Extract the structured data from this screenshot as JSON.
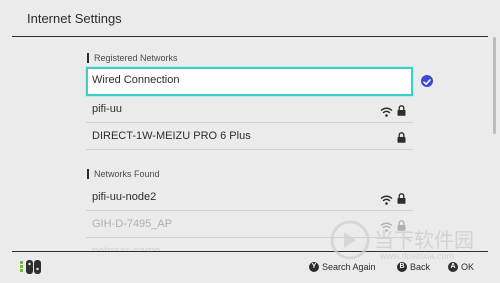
{
  "window": {
    "title": "Internet Settings"
  },
  "sections": {
    "registered": {
      "label": "Registered Networks"
    },
    "found": {
      "label": "Networks Found"
    }
  },
  "networks": {
    "registered": [
      {
        "name": "Wired Connection",
        "selected": true,
        "connected": true
      },
      {
        "name": "pifi-uu",
        "wifi": true,
        "lock": true
      },
      {
        "name": "DIRECT-1W-MEIZU PRO 6 Plus",
        "lock": true
      }
    ],
    "found": [
      {
        "name": "pifi-uu-node2",
        "wifi": true,
        "lock": true
      },
      {
        "name": "GIH-D-7495_AP",
        "wifi": true,
        "lock": true
      },
      {
        "name": "netgear-game",
        "wifi": false
      }
    ]
  },
  "footer": {
    "controller_icon": "joycon-icon",
    "hints": [
      {
        "button": "Y",
        "label": "Search Again"
      },
      {
        "button": "B",
        "label": "Back"
      },
      {
        "button": "A",
        "label": "OK"
      }
    ]
  },
  "watermark": {
    "text": "当下软件园",
    "url_text": "www.downxia.com"
  },
  "colors": {
    "accent": "#3ecfcb",
    "check": "#3a4bd6",
    "background": "#ebebeb"
  }
}
